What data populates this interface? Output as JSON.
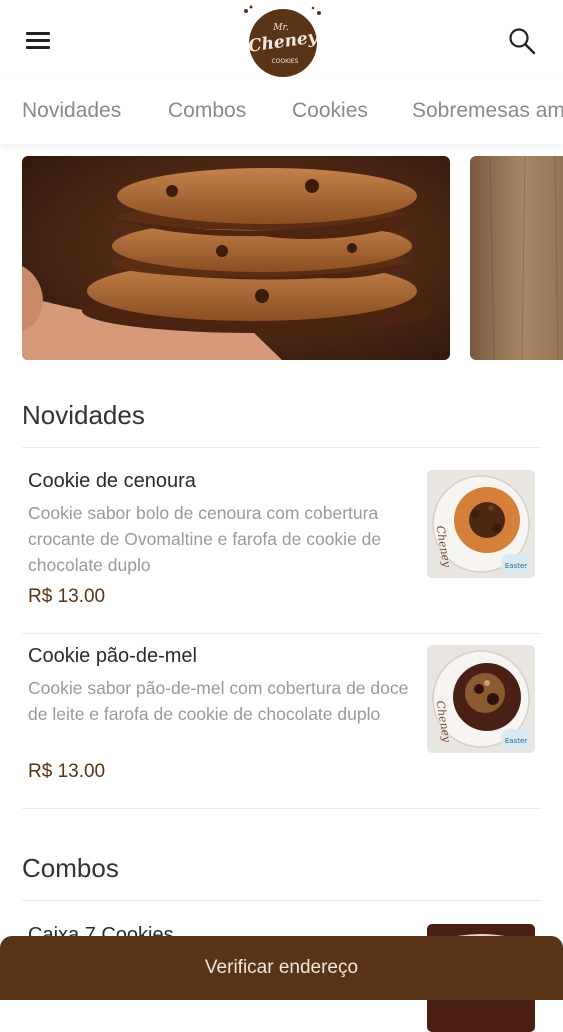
{
  "header": {
    "menu_icon": "hamburger-menu-icon",
    "search_icon": "search-icon",
    "logo": {
      "line1": "Mr.",
      "line2": "Cheney",
      "line3": "COOKIES"
    }
  },
  "tabs": [
    {
      "label": "Novidades"
    },
    {
      "label": "Combos"
    },
    {
      "label": "Cookies"
    },
    {
      "label": "Sobremesas am"
    }
  ],
  "sections": {
    "novidades": {
      "title": "Novidades",
      "items": [
        {
          "name": "Cookie de cenoura",
          "description": "Cookie sabor bolo de cenoura com cobertura crocante de Ovomaltine e farofa de cookie de chocolate duplo",
          "price": "R$ 13.00",
          "badge": "Easter"
        },
        {
          "name": "Cookie pão-de-mel",
          "description": "Cookie sabor pão-de-mel com cobertura de doce de leite e farofa de cookie de chocolate duplo",
          "price": "R$ 13.00",
          "badge": "Easter"
        }
      ]
    },
    "combos": {
      "title": "Combos",
      "items": [
        {
          "name": "Caixa 7 Cookies"
        }
      ]
    }
  },
  "bottom_bar": {
    "label": "Verificar endereço"
  },
  "colors": {
    "brand_brown": "#5a3416",
    "price_brown": "#5a3416",
    "tab_text": "#8a8a8a",
    "description_text": "#9a9a9a"
  }
}
